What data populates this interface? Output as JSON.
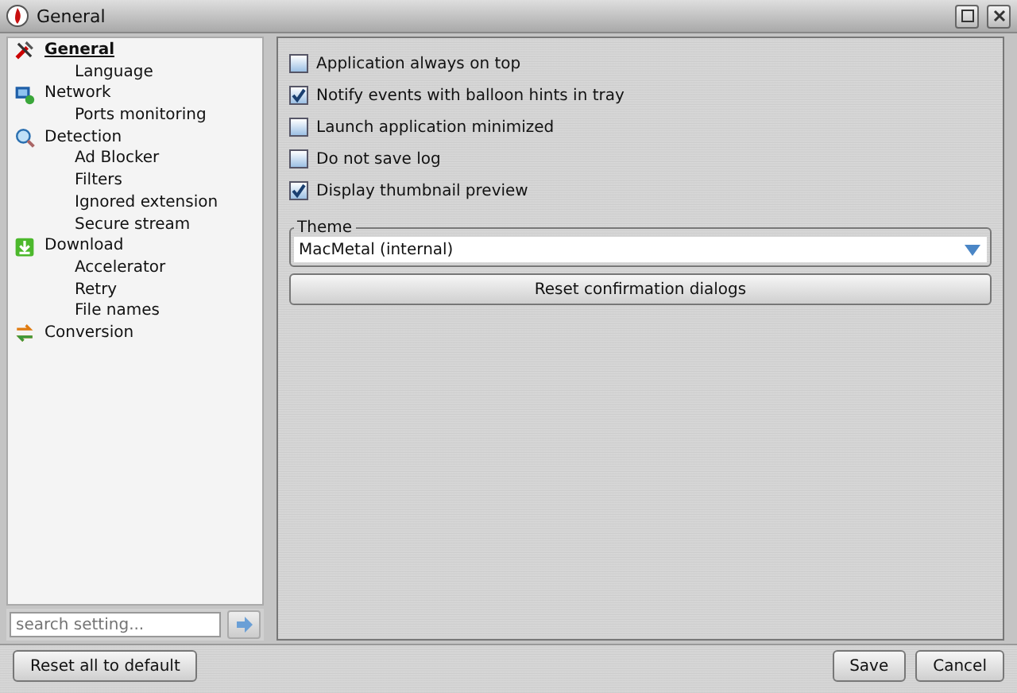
{
  "window": {
    "title": "General"
  },
  "sidebar": {
    "items": [
      {
        "label": "General",
        "selected": true,
        "children": [
          {
            "label": "Language",
            "selected": false
          }
        ]
      },
      {
        "label": "Network",
        "selected": false,
        "children": [
          {
            "label": "Ports monitoring",
            "selected": false
          }
        ]
      },
      {
        "label": "Detection",
        "selected": false,
        "children": [
          {
            "label": "Ad Blocker",
            "selected": false
          },
          {
            "label": "Filters",
            "selected": false
          },
          {
            "label": "Ignored extension",
            "selected": false
          },
          {
            "label": "Secure stream",
            "selected": false
          }
        ]
      },
      {
        "label": "Download",
        "selected": false,
        "children": [
          {
            "label": "Accelerator",
            "selected": false
          },
          {
            "label": "Retry",
            "selected": false
          },
          {
            "label": "File names",
            "selected": false
          }
        ]
      },
      {
        "label": "Conversion",
        "selected": false
      }
    ],
    "search": {
      "placeholder": "search setting..."
    }
  },
  "options": [
    {
      "label": "Application always on top",
      "checked": false
    },
    {
      "label": "Notify events with balloon hints in tray",
      "checked": true
    },
    {
      "label": "Launch application minimized",
      "checked": false
    },
    {
      "label": "Do not save log",
      "checked": false
    },
    {
      "label": "Display thumbnail preview",
      "checked": true
    }
  ],
  "theme": {
    "legend": "Theme",
    "value": "MacMetal (internal)"
  },
  "reset_dialogs_button": "Reset confirmation dialogs",
  "footer": {
    "reset_button": "Reset all to default",
    "save_button": "Save",
    "cancel_button": "Cancel"
  }
}
